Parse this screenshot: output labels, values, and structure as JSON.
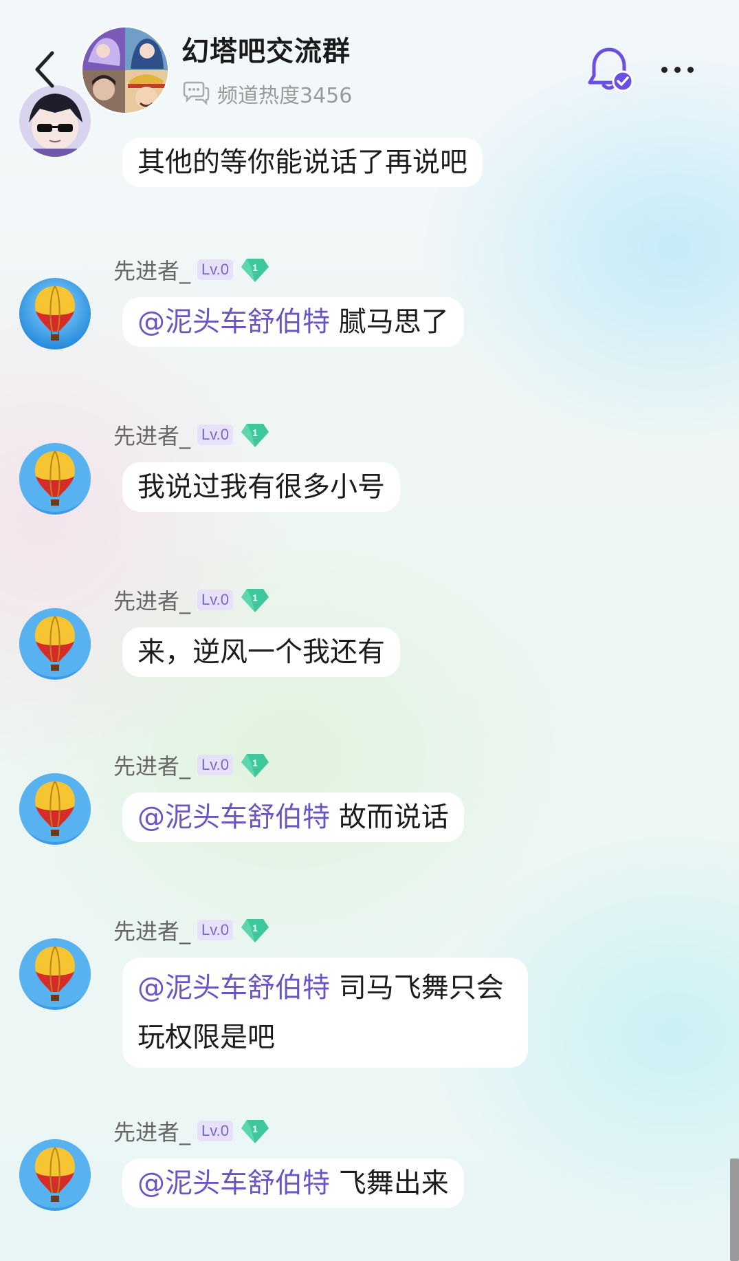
{
  "header": {
    "title": "幻塔吧交流群",
    "heat_label": "频道热度3456"
  },
  "top_partial_message": {
    "text": "其他的等你能说话了再说吧"
  },
  "messages": [
    {
      "username": "先进者_",
      "level": "Lv.0",
      "gem_number": "1",
      "mention": "@泥头车舒伯特",
      "text": " 腻马思了"
    },
    {
      "username": "先进者_",
      "level": "Lv.0",
      "gem_number": "1",
      "mention": "",
      "text": "我说过我有很多小号"
    },
    {
      "username": "先进者_",
      "level": "Lv.0",
      "gem_number": "1",
      "mention": "",
      "text": "来，逆风一个我还有"
    },
    {
      "username": "先进者_",
      "level": "Lv.0",
      "gem_number": "1",
      "mention": "@泥头车舒伯特",
      "text": " 故而说话"
    },
    {
      "username": "先进者_",
      "level": "Lv.0",
      "gem_number": "1",
      "mention": "@泥头车舒伯特",
      "text": " 司马飞舞只会",
      "text_line2": "玩权限是吧"
    },
    {
      "username": "先进者_",
      "level": "Lv.0",
      "gem_number": "1",
      "mention": "@泥头车舒伯特",
      "text": " 飞舞出来"
    }
  ],
  "icons": {
    "back": "chevron-left-icon",
    "bell": "bell-check-icon",
    "more": "more-dots-icon",
    "heat": "chat-bubble-icon",
    "gem": "gem-icon"
  },
  "colors": {
    "mention": "#6a55c2",
    "bell": "#6b4fe0",
    "gem": "#3ec79a",
    "level_badge_bg": "#e6e0f8"
  }
}
